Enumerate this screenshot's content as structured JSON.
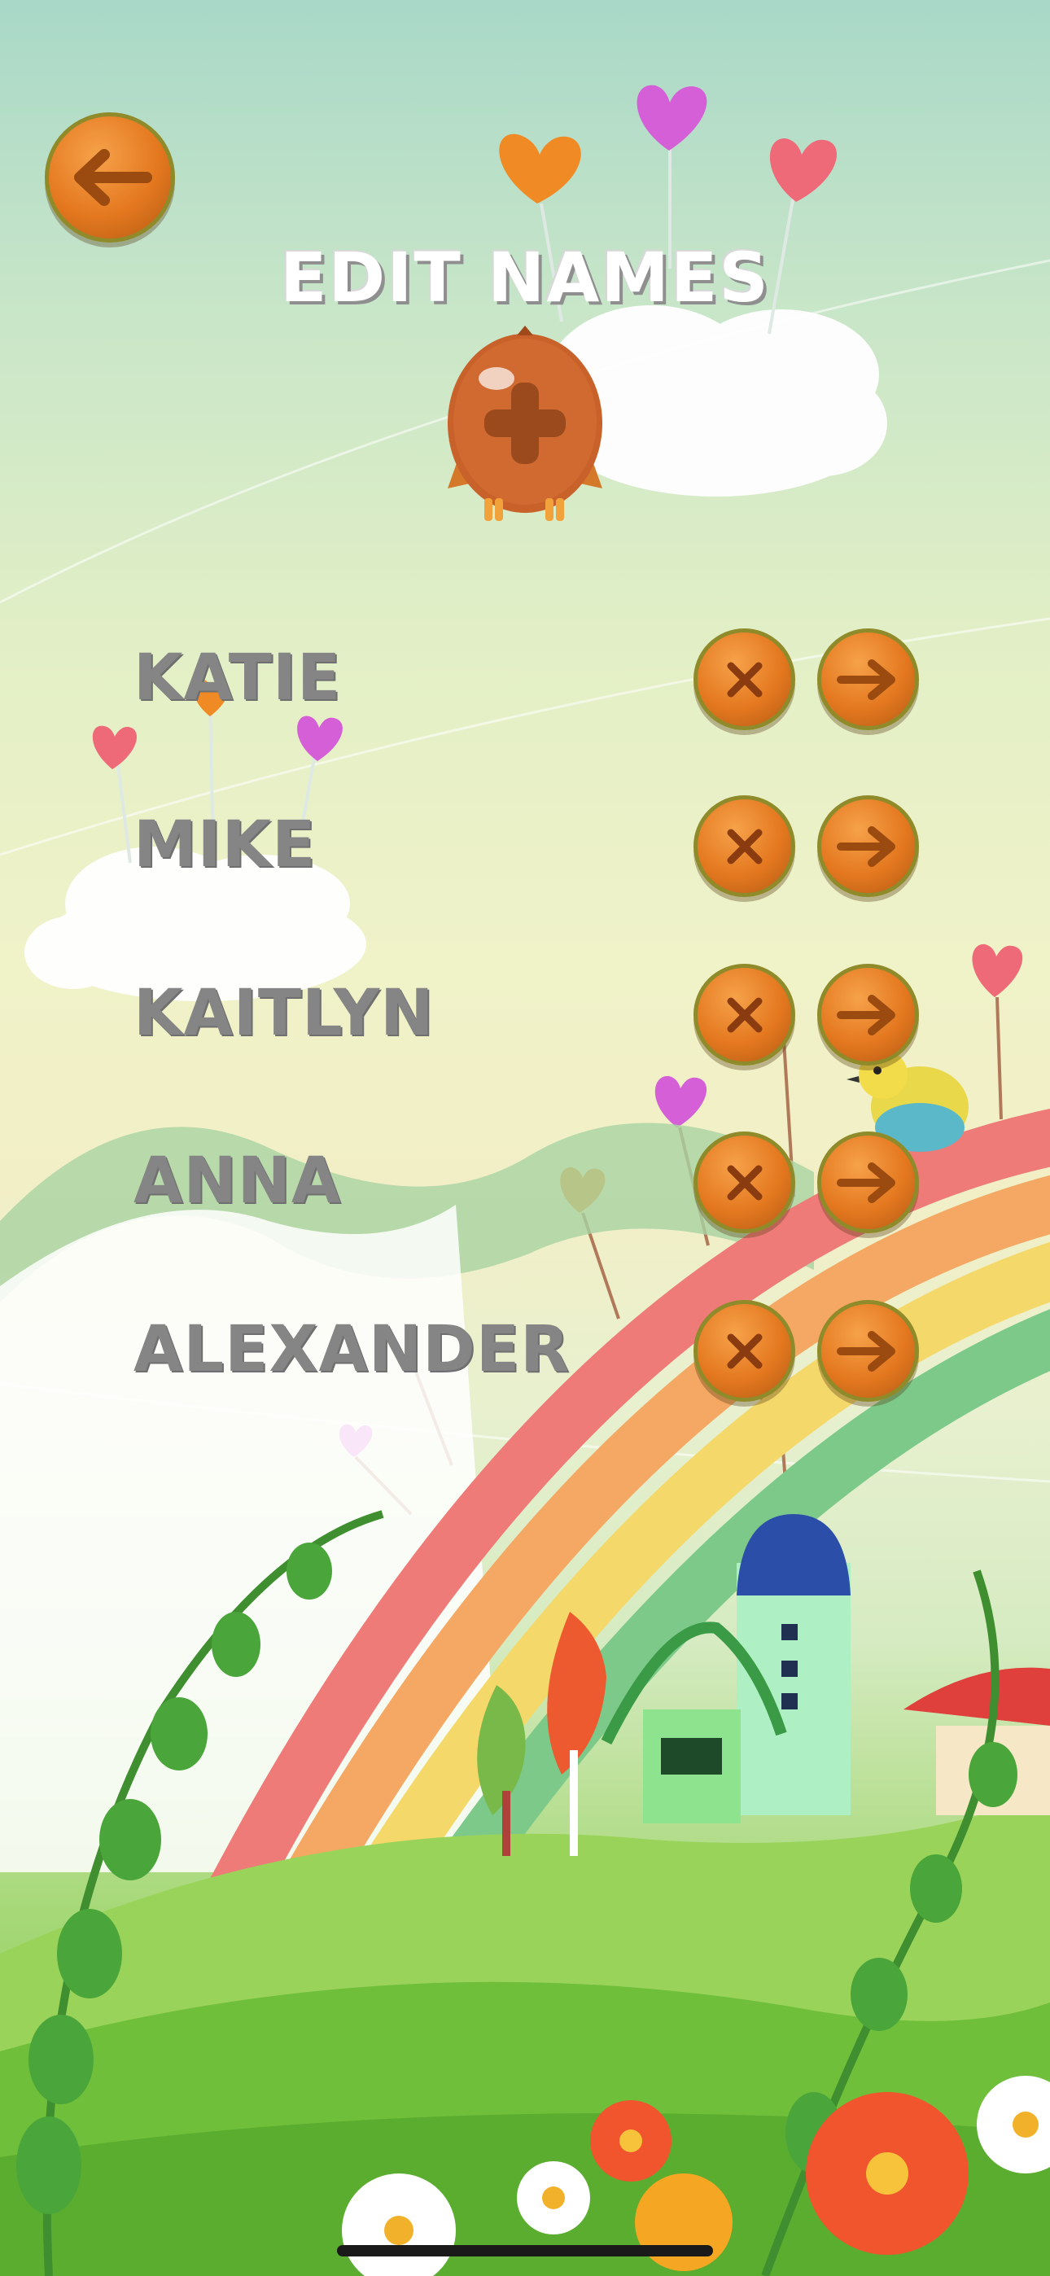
{
  "screen": {
    "title": "EDIT NAMES",
    "back_button": {
      "icon": "left-arrow-icon"
    },
    "add_button": {
      "icon": "plus-icon",
      "style": "owl"
    },
    "names": [
      {
        "name": "KATIE"
      },
      {
        "name": "MIKE"
      },
      {
        "name": "KAITLYN"
      },
      {
        "name": "ANNA"
      },
      {
        "name": "ALEXANDER"
      }
    ],
    "row_icons": {
      "delete": "x-icon",
      "select": "right-arrow-icon"
    }
  },
  "colors": {
    "button_orange": "#e4781f",
    "button_rim": "#8f8a2a",
    "name_text": "#858585",
    "title_text": "#ffffff"
  }
}
